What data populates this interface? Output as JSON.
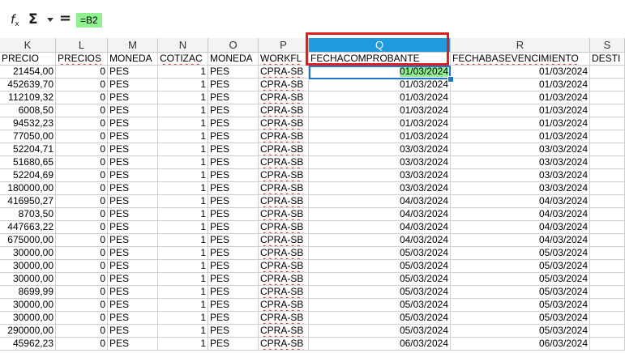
{
  "formula_bar": {
    "fx_label": "f",
    "fx_sub": "x",
    "sigma_label": "Σ",
    "equals_label": "=",
    "formula": "=B2"
  },
  "columns": [
    {
      "letter": "K"
    },
    {
      "letter": "L"
    },
    {
      "letter": "M"
    },
    {
      "letter": "N"
    },
    {
      "letter": "O"
    },
    {
      "letter": "P"
    },
    {
      "letter": "Q"
    },
    {
      "letter": "R"
    },
    {
      "letter": "S"
    }
  ],
  "header_row": [
    "PRECIO",
    "PRECIOS",
    "MONEDA",
    "COTIZAC",
    "MONEDA",
    "WORKFL",
    "FECHACOMPROBANTE",
    "FECHABASEVENCIMIENTO",
    "DESTI"
  ],
  "rows": [
    [
      "21454,00",
      "0",
      "PES",
      "1",
      "PES",
      "CPRA-SB",
      "01/03/2024",
      "01/03/2024"
    ],
    [
      "452639,70",
      "0",
      "PES",
      "1",
      "PES",
      "CPRA-SB",
      "01/03/2024",
      "01/03/2024"
    ],
    [
      "112109,32",
      "0",
      "PES",
      "1",
      "PES",
      "CPRA-SB",
      "01/03/2024",
      "01/03/2024"
    ],
    [
      "6008,50",
      "0",
      "PES",
      "1",
      "PES",
      "CPRA-SB",
      "01/03/2024",
      "01/03/2024"
    ],
    [
      "94532,23",
      "0",
      "PES",
      "1",
      "PES",
      "CPRA-SB",
      "01/03/2024",
      "01/03/2024"
    ],
    [
      "77050,00",
      "0",
      "PES",
      "1",
      "PES",
      "CPRA-SB",
      "01/03/2024",
      "01/03/2024"
    ],
    [
      "52204,71",
      "0",
      "PES",
      "1",
      "PES",
      "CPRA-SB",
      "03/03/2024",
      "03/03/2024"
    ],
    [
      "51680,65",
      "0",
      "PES",
      "1",
      "PES",
      "CPRA-SB",
      "03/03/2024",
      "03/03/2024"
    ],
    [
      "52204,69",
      "0",
      "PES",
      "1",
      "PES",
      "CPRA-SB",
      "03/03/2024",
      "03/03/2024"
    ],
    [
      "180000,00",
      "0",
      "PES",
      "1",
      "PES",
      "CPRA-SB",
      "03/03/2024",
      "03/03/2024"
    ],
    [
      "416950,27",
      "0",
      "PES",
      "1",
      "PES",
      "CPRA-SB",
      "04/03/2024",
      "04/03/2024"
    ],
    [
      "8703,50",
      "0",
      "PES",
      "1",
      "PES",
      "CPRA-SB",
      "04/03/2024",
      "04/03/2024"
    ],
    [
      "447663,22",
      "0",
      "PES",
      "1",
      "PES",
      "CPRA-SB",
      "04/03/2024",
      "04/03/2024"
    ],
    [
      "675000,00",
      "0",
      "PES",
      "1",
      "PES",
      "CPRA-SB",
      "04/03/2024",
      "04/03/2024"
    ],
    [
      "30000,00",
      "0",
      "PES",
      "1",
      "PES",
      "CPRA-SB",
      "05/03/2024",
      "05/03/2024"
    ],
    [
      "30000,00",
      "0",
      "PES",
      "1",
      "PES",
      "CPRA-SB",
      "05/03/2024",
      "05/03/2024"
    ],
    [
      "30000,00",
      "0",
      "PES",
      "1",
      "PES",
      "CPRA-SB",
      "05/03/2024",
      "05/03/2024"
    ],
    [
      "8699,99",
      "0",
      "PES",
      "1",
      "PES",
      "CPRA-SB",
      "05/03/2024",
      "05/03/2024"
    ],
    [
      "30000,00",
      "0",
      "PES",
      "1",
      "PES",
      "CPRA-SB",
      "05/03/2024",
      "05/03/2024"
    ],
    [
      "30000,00",
      "0",
      "PES",
      "1",
      "PES",
      "CPRA-SB",
      "05/03/2024",
      "05/03/2024"
    ],
    [
      "290000,00",
      "0",
      "PES",
      "1",
      "PES",
      "CPRA-SB",
      "05/03/2024",
      "05/03/2024"
    ],
    [
      "45962,23",
      "0",
      "PES",
      "1",
      "PES",
      "CPRA-SB",
      "06/03/2024",
      "06/03/2024"
    ]
  ],
  "selection": {
    "column": "Q",
    "active_row_index": 0
  },
  "colors": {
    "selected_header": "#1e9be0",
    "highlight": "#8ff08f",
    "callout": "#e21b1b",
    "active_border": "#1e78d0"
  }
}
